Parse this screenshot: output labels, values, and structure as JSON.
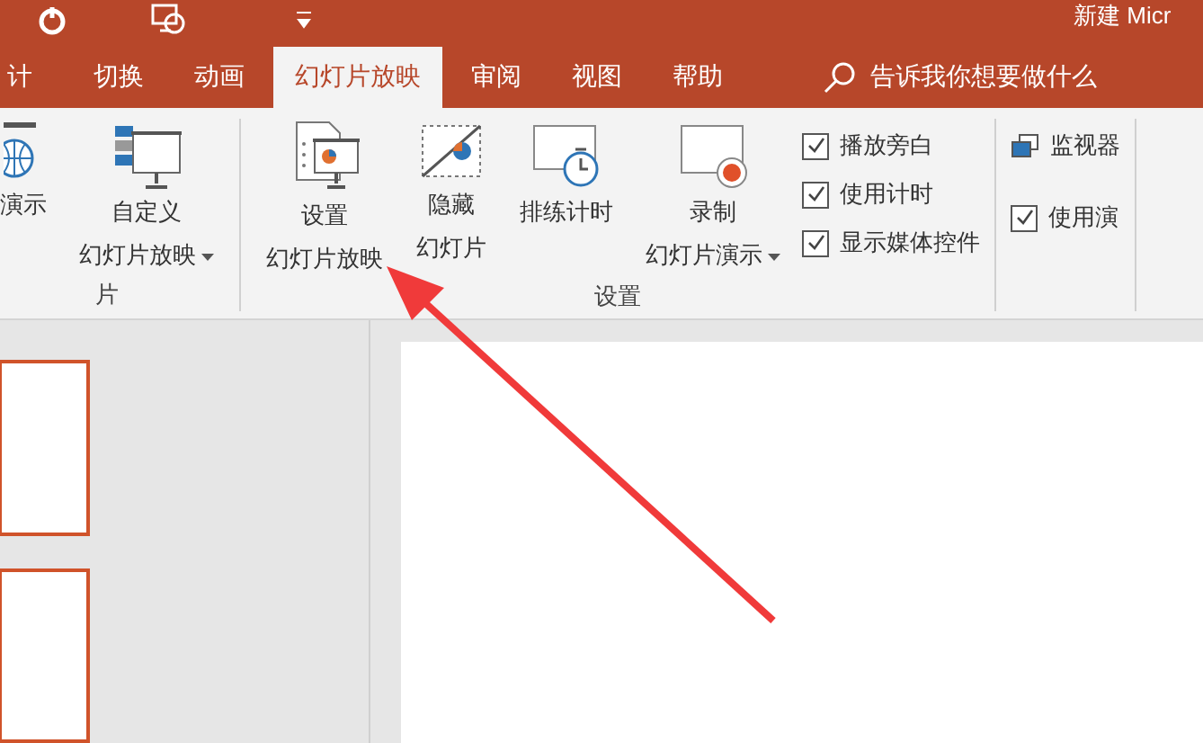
{
  "window": {
    "title": "新建 Micr"
  },
  "tabs": [
    {
      "label": "计",
      "selected": false
    },
    {
      "label": "切换",
      "selected": false
    },
    {
      "label": "动画",
      "selected": false
    },
    {
      "label": "幻灯片放映",
      "selected": true
    },
    {
      "label": "审阅",
      "selected": false
    },
    {
      "label": "视图",
      "selected": false
    },
    {
      "label": "帮助",
      "selected": false
    }
  ],
  "search": {
    "placeholder": "告诉我你想要做什么"
  },
  "ribbon": {
    "groups": [
      {
        "label": "片",
        "items": [
          {
            "kind": "large",
            "lines": [
              "演示"
            ],
            "dropdown": false
          },
          {
            "kind": "large",
            "lines": [
              "自定义",
              "幻灯片放映"
            ],
            "dropdown": true
          }
        ]
      },
      {
        "label": "设置",
        "items": [
          {
            "kind": "large",
            "lines": [
              "设置",
              "幻灯片放映"
            ],
            "dropdown": false
          },
          {
            "kind": "large",
            "lines": [
              "隐藏",
              "幻灯片"
            ],
            "dropdown": false
          },
          {
            "kind": "large",
            "lines": [
              "排练计时"
            ],
            "dropdown": false
          },
          {
            "kind": "large",
            "lines": [
              "录制",
              "幻灯片演示"
            ],
            "dropdown": true
          },
          {
            "kind": "checks",
            "checks": [
              {
                "label": "播放旁白",
                "checked": true
              },
              {
                "label": "使用计时",
                "checked": true
              },
              {
                "label": "显示媒体控件",
                "checked": true
              }
            ]
          }
        ]
      },
      {
        "items": [
          {
            "kind": "small",
            "label": "监视器"
          },
          {
            "kind": "checks",
            "checks": [
              {
                "label": "使用演",
                "checked": true
              }
            ]
          }
        ]
      }
    ]
  }
}
